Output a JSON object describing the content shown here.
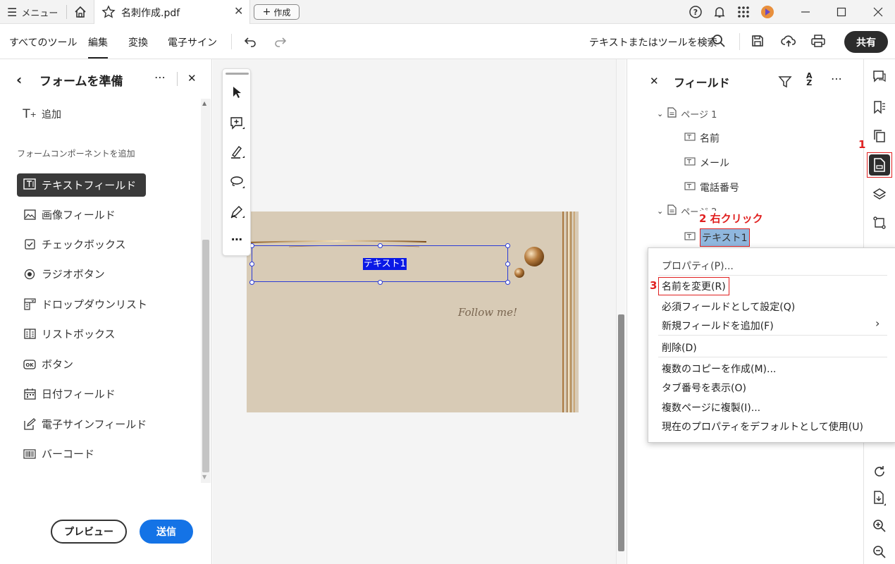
{
  "titlebar": {
    "menu_label": "メニュー",
    "tab_name": "名刺作成.pdf",
    "new_tab_label": "作成"
  },
  "toolbar": {
    "tabs": [
      "すべてのツール",
      "編集",
      "変換",
      "電子サイン"
    ],
    "active_tab": "編集",
    "search_label": "テキストまたはツールを検索",
    "share_label": "共有"
  },
  "left_panel": {
    "title": "フォームを準備",
    "add_label": "追加",
    "section_label": "フォームコンポーネントを追加",
    "components": [
      {
        "label": "テキストフィールド",
        "icon": "text-field-icon"
      },
      {
        "label": "画像フィールド",
        "icon": "image-field-icon"
      },
      {
        "label": "チェックボックス",
        "icon": "checkbox-icon"
      },
      {
        "label": "ラジオボタン",
        "icon": "radio-icon"
      },
      {
        "label": "ドロップダウンリスト",
        "icon": "dropdown-icon"
      },
      {
        "label": "リストボックス",
        "icon": "listbox-icon"
      },
      {
        "label": "ボタン",
        "icon": "button-icon"
      },
      {
        "label": "日付フィールド",
        "icon": "date-icon"
      },
      {
        "label": "電子サインフィールド",
        "icon": "signature-icon"
      },
      {
        "label": "バーコード",
        "icon": "barcode-icon"
      }
    ],
    "preview_label": "プレビュー",
    "send_label": "送信"
  },
  "document": {
    "field_label": "テキスト1",
    "card_script": "Follow me!"
  },
  "fields_panel": {
    "title": "フィールド",
    "pages": [
      {
        "label": "ページ 1",
        "fields": [
          "名前",
          "メール",
          "電話番号"
        ]
      },
      {
        "label": "ページ 2",
        "fields": [
          "テキスト1"
        ]
      }
    ]
  },
  "annotations": {
    "step1": "1",
    "step2": "2 右クリック",
    "step3": "3"
  },
  "context_menu": {
    "items": [
      "プロパティ(P)...",
      "名前を変更(R)",
      "必須フィールドとして設定(Q)",
      "新規フィールドを追加(F)",
      "削除(D)",
      "複数のコピーを作成(M)...",
      "タブ番号を表示(O)",
      "複数ページに複製(I)...",
      "現在のプロパティをデフォルトとして使用(U)"
    ],
    "submenu_arrow": "›"
  },
  "colors": {
    "accent_blue": "#1473e6",
    "annotation_red": "#e02020",
    "field_selection": "#0a19e6",
    "card_bg": "#d8cbb6"
  }
}
